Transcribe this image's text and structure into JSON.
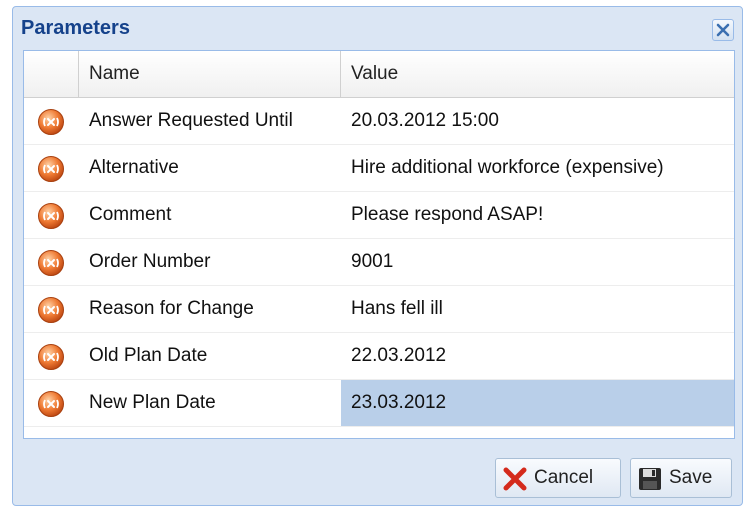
{
  "dialog": {
    "title": "Parameters",
    "close_icon": "close-icon"
  },
  "grid": {
    "columns": {
      "name": "Name",
      "value": "Value"
    },
    "rows": [
      {
        "icon": "variable-icon",
        "name": "Answer Requested Until",
        "value": "20.03.2012 15:00"
      },
      {
        "icon": "variable-icon",
        "name": "Alternative",
        "value": "Hire additional workforce (expensive)"
      },
      {
        "icon": "variable-icon",
        "name": "Comment",
        "value": "Please respond ASAP!"
      },
      {
        "icon": "variable-icon",
        "name": "Order Number",
        "value": "9001"
      },
      {
        "icon": "variable-icon",
        "name": "Reason for Change",
        "value": "Hans fell ill"
      },
      {
        "icon": "variable-icon",
        "name": "Old Plan Date",
        "value": "22.03.2012"
      },
      {
        "icon": "variable-icon",
        "name": "New Plan Date",
        "value": "23.03.2012",
        "selected": true
      }
    ]
  },
  "buttons": {
    "cancel_label": "Cancel",
    "cancel_icon": "cancel-icon",
    "save_label": "Save",
    "save_icon": "save-icon"
  },
  "colors": {
    "title": "#15428b",
    "selection": "#b9cfe9",
    "frame": "#dbe6f4",
    "icon": "#e8621e"
  }
}
